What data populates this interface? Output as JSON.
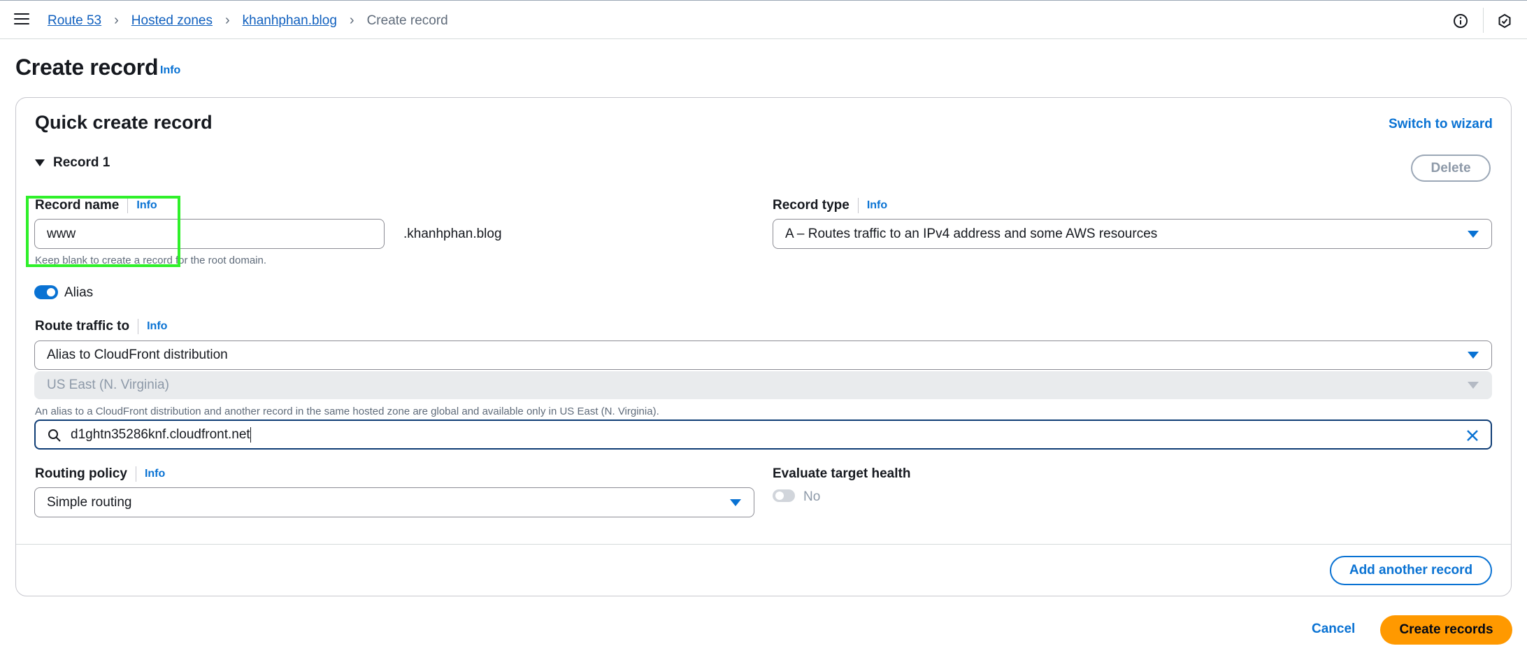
{
  "breadcrumb": {
    "items": [
      "Route 53",
      "Hosted zones",
      "khanhphan.blog"
    ],
    "current": "Create record"
  },
  "page": {
    "title": "Create record",
    "info": "Info"
  },
  "card": {
    "title": "Quick create record",
    "switch_label": "Switch to wizard",
    "record_label": "Record 1",
    "delete_label": "Delete"
  },
  "record_name": {
    "label": "Record name",
    "info": "Info",
    "value": "www",
    "domain_suffix": ".khanhphan.blog",
    "hint": "Keep blank to create a record for the root domain."
  },
  "record_type": {
    "label": "Record type",
    "info": "Info",
    "value": "A – Routes traffic to an IPv4 address and some AWS resources"
  },
  "alias": {
    "label": "Alias",
    "enabled": true
  },
  "route_traffic": {
    "label": "Route traffic to",
    "info": "Info",
    "endpoint": "Alias to CloudFront distribution",
    "region": "US East (N. Virginia)",
    "hint": "An alias to a CloudFront distribution and another record in the same hosted zone are global and available only in US East (N. Virginia).",
    "distribution_value": "d1ghtn35286knf.cloudfront.net"
  },
  "routing_policy": {
    "label": "Routing policy",
    "info": "Info",
    "value": "Simple routing"
  },
  "evaluate_health": {
    "label": "Evaluate target health",
    "state_label": "No",
    "enabled": false
  },
  "actions": {
    "add_another": "Add another record",
    "cancel": "Cancel",
    "create": "Create records"
  },
  "colors": {
    "accent": "#0972d3",
    "primary_button": "#ff9900",
    "highlight_box": "#2ff02a"
  },
  "icons": [
    "menu-icon",
    "chevron-right-icon",
    "info-circle-icon",
    "notifications-icon",
    "caret-down-icon",
    "search-icon",
    "clear-icon"
  ]
}
